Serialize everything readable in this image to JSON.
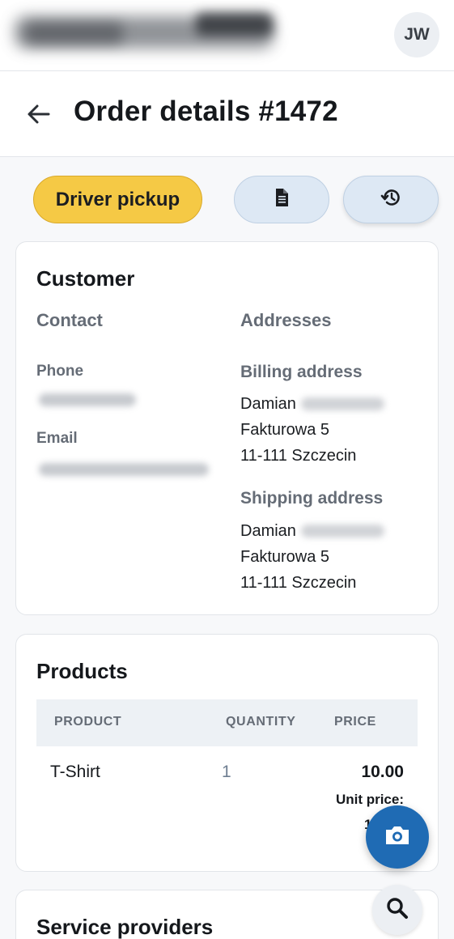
{
  "header": {
    "avatar_initials": "JW"
  },
  "titlebar": {
    "back_icon": "arrow-left-icon",
    "title": "Order details #1472"
  },
  "actions": {
    "status_label": "Driver pickup",
    "status_color": "#f5c945",
    "document_icon": "document-icon",
    "history_icon": "history-icon"
  },
  "customer": {
    "title": "Customer",
    "contact": {
      "heading": "Contact",
      "phone_label": "Phone",
      "email_label": "Email"
    },
    "addresses": {
      "heading": "Addresses",
      "billing": {
        "label": "Billing address",
        "name": "Damian",
        "street": "Fakturowa 5",
        "city": "11-111 Szczecin"
      },
      "shipping": {
        "label": "Shipping address",
        "name": "Damian",
        "street": "Fakturowa 5",
        "city": "11-111 Szczecin"
      }
    }
  },
  "products": {
    "title": "Products",
    "columns": [
      "PRODUCT",
      "QUANTITY",
      "PRICE"
    ],
    "rows": [
      {
        "product": "T-Shirt",
        "quantity": "1",
        "price": "10.00",
        "unit_price_label": "Unit price:",
        "unit_price_value": "1"
      }
    ]
  },
  "services": {
    "title": "Service providers"
  },
  "fabs": {
    "camera_icon": "camera-icon",
    "search_icon": "search-icon"
  },
  "colors": {
    "accent": "#1f6bb4",
    "status_yellow": "#f5c945",
    "secondary_button": "#dde8f4"
  }
}
